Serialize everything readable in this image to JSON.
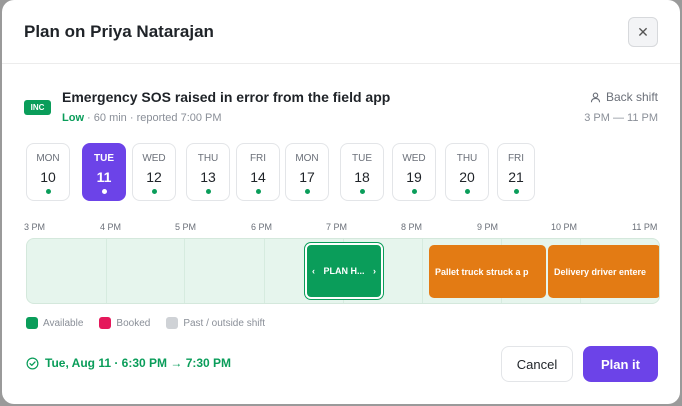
{
  "dialog": {
    "title": "Plan on Priya Natarajan",
    "close_icon": "close-icon"
  },
  "incident": {
    "badge": "INC",
    "title": "Emergency SOS raised in error from the field app",
    "priority": "Low",
    "meta": " · 60 min · reported 7:00 PM",
    "shift_label": "Back shift",
    "shift_icon": "person-icon",
    "shift_time": "3 PM — 11 PM"
  },
  "days": [
    {
      "dow": "MON",
      "num": "10",
      "selected": false
    },
    {
      "dow": "TUE",
      "num": "11",
      "selected": true
    },
    {
      "dow": "WED",
      "num": "12",
      "selected": false
    },
    {
      "dow": "THU",
      "num": "13",
      "selected": false
    },
    {
      "dow": "FRI",
      "num": "14",
      "selected": false
    },
    {
      "dow": "MON",
      "num": "17",
      "selected": false
    },
    {
      "dow": "TUE",
      "num": "18",
      "selected": false
    },
    {
      "dow": "WED",
      "num": "19",
      "selected": false
    },
    {
      "dow": "THU",
      "num": "20",
      "selected": false
    },
    {
      "dow": "FRI",
      "num": "21",
      "selected": false
    }
  ],
  "timeline": {
    "hours": [
      "3 PM",
      "4 PM",
      "5 PM",
      "6 PM",
      "7 PM",
      "8 PM",
      "9 PM",
      "10 PM",
      "11 PM"
    ],
    "plan_block_label": "PLAN H...",
    "events": [
      {
        "label": "Pallet truck struck a p"
      },
      {
        "label": "Delivery driver entere"
      }
    ]
  },
  "legend": [
    {
      "label": "Available",
      "color": "#0a9d5a"
    },
    {
      "label": "Booked",
      "color": "#e5185b"
    },
    {
      "label": "Past / outside shift",
      "color": "#cfd2d6"
    }
  ],
  "footer": {
    "selection": "Tue, Aug 11 · 6:30 PM → 7:30 PM",
    "selection_icon": "check-circle-icon",
    "cancel_label": "Cancel",
    "plan_label": "Plan it"
  },
  "colors": {
    "accent": "#6c43e8",
    "available": "#0a9d5a",
    "booked_event": "#e37b14"
  }
}
